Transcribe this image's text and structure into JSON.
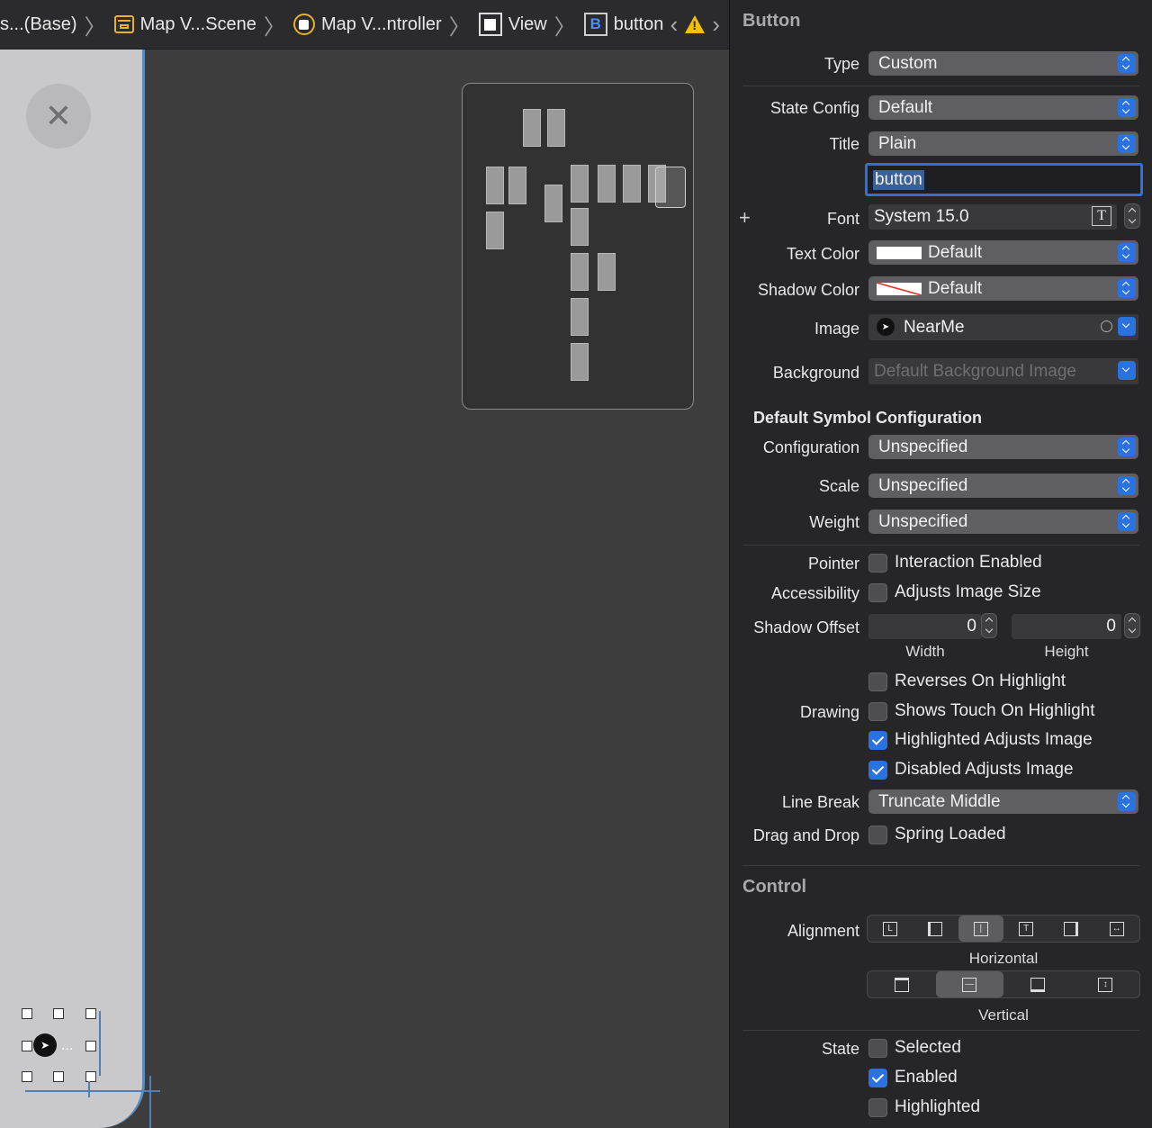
{
  "breadcrumb": {
    "items": [
      "s...(Base)",
      "Map V...Scene",
      "Map V...ntroller",
      "View",
      "button"
    ],
    "b_badge": "B"
  },
  "canvas": {
    "close_glyph": "✕",
    "selected_button_glyph": "➤",
    "ellipsis": "..."
  },
  "inspector": {
    "button_section": "Button",
    "type_label": "Type",
    "type_value": "Custom",
    "state_config_label": "State Config",
    "state_config_value": "Default",
    "title_label": "Title",
    "title_value": "Plain",
    "title_text": "button",
    "font_label": "Font",
    "font_value": "System 15.0",
    "font_add": "+",
    "text_color_label": "Text Color",
    "text_color_value": "Default",
    "shadow_color_label": "Shadow Color",
    "shadow_color_value": "Default",
    "image_label": "Image",
    "image_value": "NearMe",
    "background_label": "Background",
    "background_placeholder": "Default Background Image",
    "symbol_config_header": "Default Symbol Configuration",
    "configuration_label": "Configuration",
    "configuration_value": "Unspecified",
    "scale_label": "Scale",
    "scale_value": "Unspecified",
    "weight_label": "Weight",
    "weight_value": "Unspecified",
    "pointer_label": "Pointer",
    "pointer_option": "Interaction Enabled",
    "accessibility_label": "Accessibility",
    "accessibility_option": "Adjusts Image Size",
    "shadow_offset_label": "Shadow Offset",
    "shadow_width": "0",
    "shadow_height": "0",
    "width_label": "Width",
    "height_label": "Height",
    "drawing_label": "Drawing",
    "drawing_options": [
      {
        "label": "Reverses On Highlight",
        "checked": false
      },
      {
        "label": "Shows Touch On Highlight",
        "checked": false
      },
      {
        "label": "Highlighted Adjusts Image",
        "checked": true
      },
      {
        "label": "Disabled Adjusts Image",
        "checked": true
      }
    ],
    "line_break_label": "Line Break",
    "line_break_value": "Truncate Middle",
    "drag_drop_label": "Drag and Drop",
    "drag_drop_option": "Spring Loaded",
    "control_section": "Control",
    "alignment_label": "Alignment",
    "horizontal_label": "Horizontal",
    "vertical_label": "Vertical",
    "state_label": "State",
    "state_options": [
      {
        "label": "Selected",
        "checked": false
      },
      {
        "label": "Enabled",
        "checked": true
      },
      {
        "label": "Highlighted",
        "checked": false
      }
    ]
  },
  "colors": {
    "accent": "#2a72e0",
    "warning": "#f4c000",
    "storyboard": "#e6b12b"
  }
}
